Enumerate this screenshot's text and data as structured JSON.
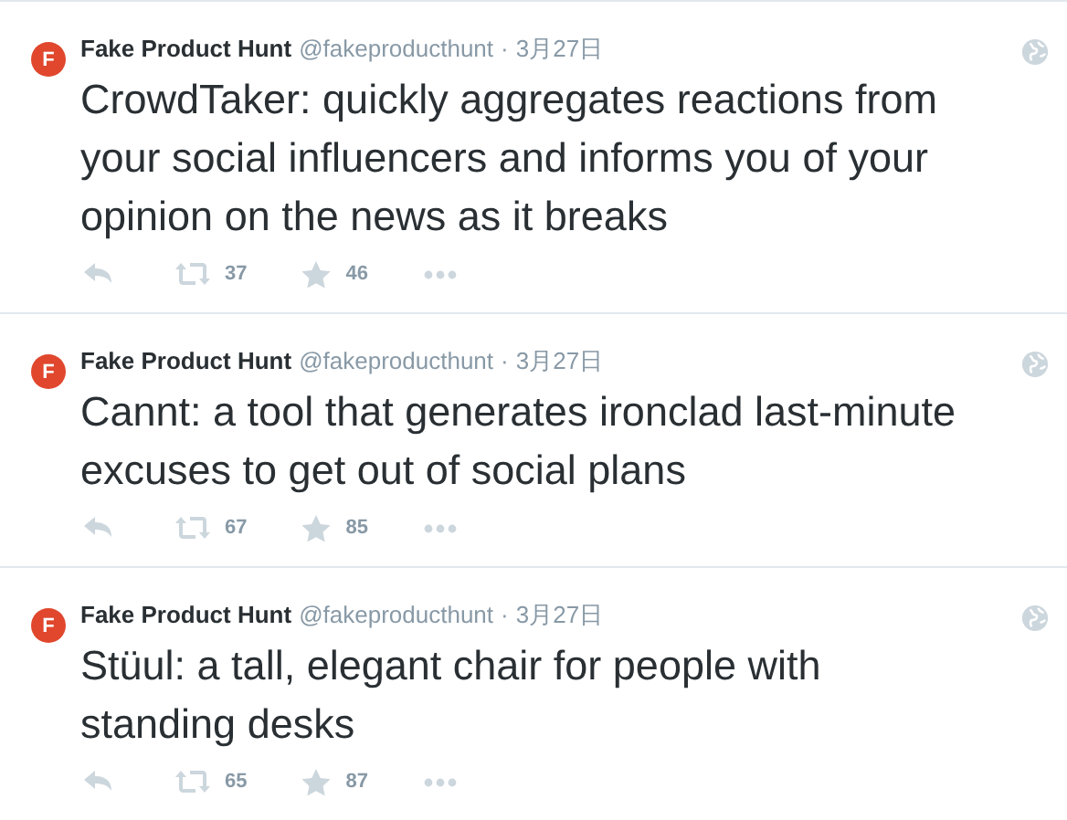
{
  "tweets": [
    {
      "avatar": "F",
      "name": "Fake Product Hunt",
      "handle": "@fakeproducthunt",
      "separator": "·",
      "date": "3月27日",
      "text": "CrowdTaker: quickly aggregates reactions from your social influencers and informs you of your opinion on the news as it breaks",
      "retweets": "37",
      "favorites": "46"
    },
    {
      "avatar": "F",
      "name": "Fake Product Hunt",
      "handle": "@fakeproducthunt",
      "separator": "·",
      "date": "3月27日",
      "text": "Cannt: a tool that generates ironclad last-minute excuses to get out of social plans",
      "retweets": "67",
      "favorites": "85"
    },
    {
      "avatar": "F",
      "name": "Fake Product Hunt",
      "handle": "@fakeproducthunt",
      "separator": "·",
      "date": "3月27日",
      "text": "Stüul: a tall, elegant chair for people with standing desks",
      "retweets": "65",
      "favorites": "87"
    }
  ]
}
